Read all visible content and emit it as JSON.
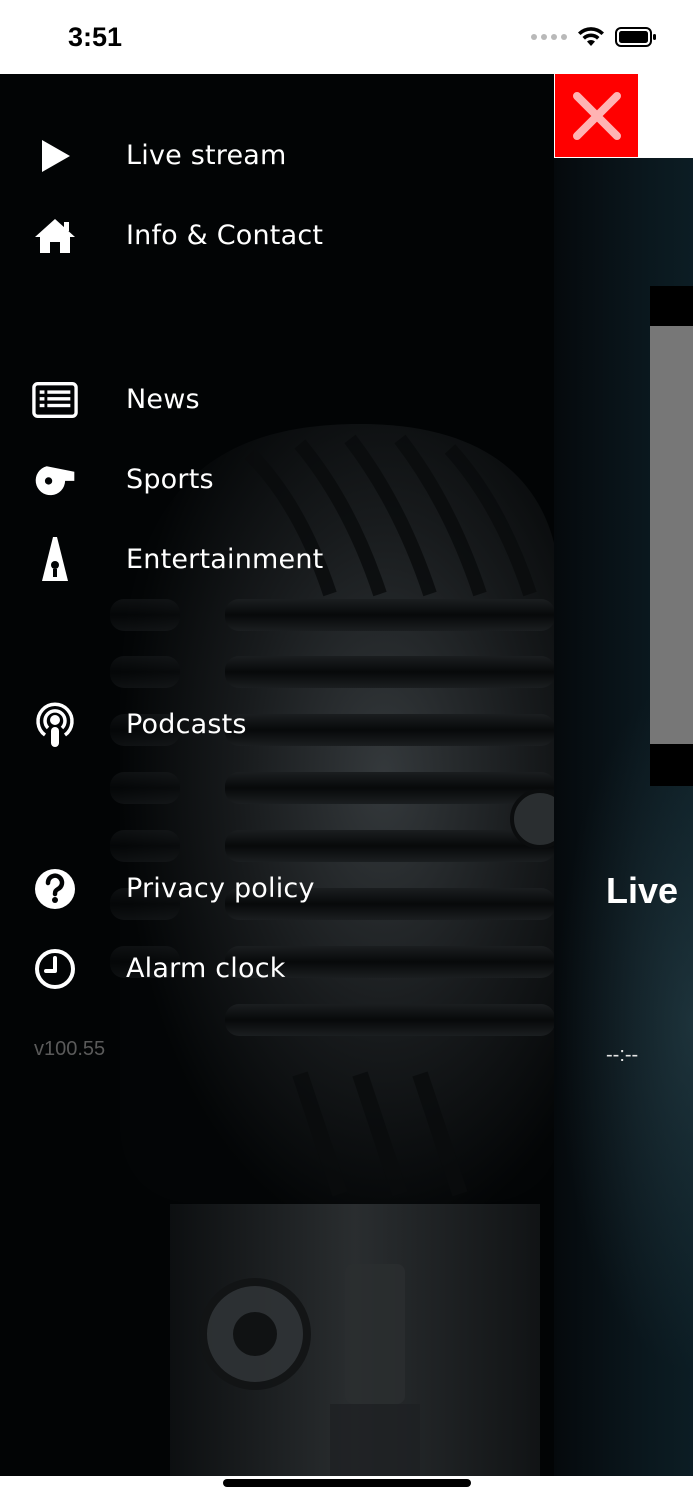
{
  "status_bar": {
    "time": "3:51",
    "icons": [
      "signal-icon",
      "wifi-icon",
      "battery-icon"
    ]
  },
  "drawer": {
    "menu": [
      {
        "label": "Live stream",
        "icon": "play-icon"
      },
      {
        "label": "Info & Contact",
        "icon": "home-icon"
      },
      {
        "label": "News",
        "icon": "newspaper-icon"
      },
      {
        "label": "Sports",
        "icon": "whistle-icon"
      },
      {
        "label": "Entertainment",
        "icon": "spotlight-icon"
      },
      {
        "label": "Podcasts",
        "icon": "podcast-icon"
      },
      {
        "label": "Privacy policy",
        "icon": "question-icon"
      },
      {
        "label": "Alarm clock",
        "icon": "clock-icon"
      }
    ],
    "version": "v100.55"
  },
  "main": {
    "title": "Live",
    "time": "--:--"
  },
  "colors": {
    "close_button": "#ff0000",
    "drawer_background": "#020405",
    "text": "#ffffff",
    "version_text": "#5a5a5a"
  }
}
